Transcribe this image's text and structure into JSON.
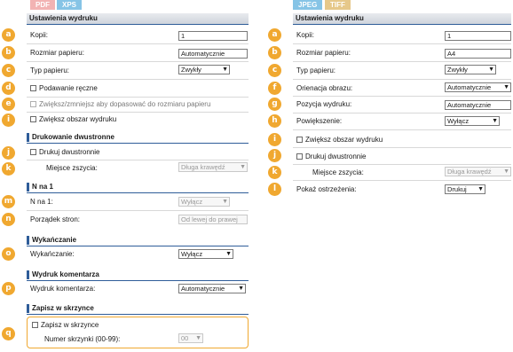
{
  "left": {
    "tabs": [
      "PDF",
      "XPS"
    ],
    "header": "Ustawienia wydruku",
    "rows": {
      "kopii": {
        "label": "Kopii:",
        "value": "1"
      },
      "rozmiar": {
        "label": "Rozmiar papieru:",
        "value": "Automatycznie"
      },
      "typ": {
        "label": "Typ papieru:",
        "value": "Zwykły"
      },
      "podawanie": {
        "label": "Podawanie ręczne"
      },
      "zwieksz_zmniejsz": {
        "label": "Zwiększ/zmniejsz aby dopasować do rozmiaru papieru"
      },
      "obszar": {
        "label": "Zwiększ obszar wydruku"
      }
    },
    "duplex": {
      "header": "Drukowanie dwustronne",
      "drukuj": {
        "label": "Drukuj dwustronnie"
      },
      "miejsce": {
        "label": "Miejsce zszycia:",
        "value": "Długa krawędź"
      }
    },
    "nup": {
      "header": "N na 1",
      "nna1": {
        "label": "N na 1:",
        "value": "Wyłącz"
      },
      "porzadek": {
        "label": "Porządek stron:",
        "value": "Od lewej do prawej"
      }
    },
    "finishing": {
      "header": "Wykańczanie",
      "wyk": {
        "label": "Wykańczanie:",
        "value": "Wyłącz"
      }
    },
    "comment": {
      "header": "Wydruk komentarza",
      "wyd": {
        "label": "Wydruk komentarza:",
        "value": "Automatycznie"
      }
    },
    "box": {
      "header": "Zapisz w skrzynce",
      "zapisz": {
        "label": "Zapisz w skrzynce"
      },
      "numer": {
        "label": "Numer skrzynki (00-99):",
        "value": "00"
      }
    }
  },
  "right": {
    "tabs": [
      "JPEG",
      "TIFF"
    ],
    "header": "Ustawienia wydruku",
    "rows": {
      "kopii": {
        "label": "Kopii:",
        "value": "1"
      },
      "rozmiar": {
        "label": "Rozmiar papieru:",
        "value": "A4"
      },
      "typ": {
        "label": "Typ papieru:",
        "value": "Zwykły"
      },
      "orientacja": {
        "label": "Orienacja obrazu:",
        "value": "Automatycznie"
      },
      "pozycja": {
        "label": "Pozycja wydruku:",
        "value": "Automatycznie"
      },
      "powiekszenie": {
        "label": "Powiększenie:",
        "value": "Wyłącz"
      },
      "obszar": {
        "label": "Zwiększ obszar wydruku"
      },
      "dwustronnie": {
        "label": "Drukuj dwustronnie"
      },
      "miejsce": {
        "label": "Miejsce zszycia:",
        "value": "Długa krawędź"
      },
      "ostrzezenia": {
        "label": "Pokaż ostrzeżenia:",
        "value": "Drukuj"
      }
    }
  },
  "badges": {
    "a": "a",
    "b": "b",
    "c": "c",
    "d": "d",
    "e": "e",
    "f": "f",
    "g": "g",
    "h": "h",
    "i": "i",
    "j": "j",
    "k": "k",
    "l": "l",
    "m": "m",
    "n": "n",
    "o": "o",
    "p": "p",
    "q": "q"
  },
  "icons": {
    "dropdown": "chevron-down-icon",
    "checkbox": "checkbox-icon"
  },
  "colors": {
    "badge": "#f0a830",
    "section_line": "#2f5d99",
    "tab_pdf": "#f2b3b3",
    "tab_xps": "#86c4e6",
    "tab_tiff": "#e6c88a"
  }
}
